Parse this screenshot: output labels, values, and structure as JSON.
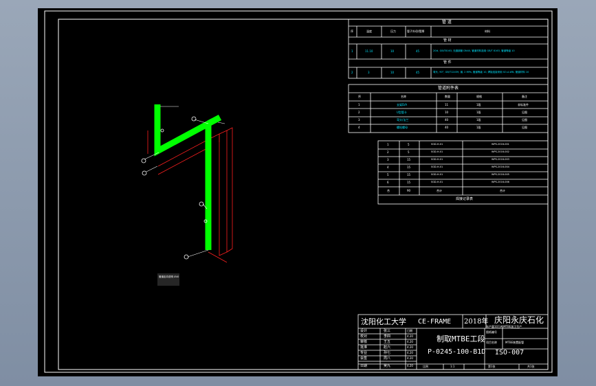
{
  "colors": {
    "background": "#000000",
    "frame": "#ffffff",
    "pipe": "#00ff00",
    "dimension": "#ff2020",
    "cyan_text": "#00e5ff"
  },
  "top_table": {
    "title": "管 道",
    "headers": [
      "序",
      "温度",
      "压力",
      "管子外径/壁厚",
      "材料"
    ],
    "section1": "管 材",
    "row1": [
      "1",
      "11.10",
      "10",
      "45",
      "20#, GB/T8163, 无缝钢管 DN40, 管道材料选用 GB/T 8163, 管道等级 10"
    ],
    "section2": "管 件",
    "row2": [
      "2",
      "3",
      "10",
      "45",
      "弯头, 90°, GB/T12459, 钢, 2 MPa, 管道等级 10, 焊接连接采用 SO-A-WN, 管道材料 10"
    ]
  },
  "mid_table": {
    "title": "管道附件表",
    "headers": [
      "序",
      "名称",
      "数量",
      "规格",
      "备注"
    ],
    "rows": [
      [
        "1",
        "支架D/A",
        "11",
        "1段",
        "非标准件"
      ],
      [
        "2",
        "U型管卡",
        "10",
        "1段",
        "见图"
      ],
      [
        "3",
        "弯头/法兰",
        "40",
        "1段",
        "见图"
      ],
      [
        "4",
        "螺栓螺母",
        "40",
        "1段",
        "见图"
      ]
    ]
  },
  "weld_table": {
    "rows": [
      [
        "1",
        "5",
        "SGD-H-01",
        "WPS-2016-001"
      ],
      [
        "2",
        "5",
        "SGD-H-01",
        "WPS-2016-002"
      ],
      [
        "3",
        "15",
        "SGD-H-01",
        "WPS-2016-003"
      ],
      [
        "4",
        "15",
        "SGD-H-01",
        "WPS-2016-004"
      ],
      [
        "5",
        "15",
        "SGD-H-01",
        "WPS-2016-005"
      ],
      [
        "6",
        "15",
        "SGD-H-01",
        "WPS-2016-006"
      ],
      [
        "合",
        "90",
        "合计",
        "合计"
      ]
    ],
    "footer": "焊接记录表"
  },
  "title_block": {
    "school": "沈阳化工大学",
    "frame": "CE-FRAME",
    "year": "2018年",
    "company": "庆阳永庆石化",
    "note": "年产量10万吨MTBE加工生产",
    "roles": [
      "设计",
      "校对",
      "审核",
      "批准",
      "专业",
      "会签",
      "日期"
    ],
    "names": [
      "张三",
      "李四",
      "王五",
      "赵六",
      "孙七",
      "周八",
      "吴九"
    ],
    "stamps": [
      "日期",
      "4.20",
      "4.20",
      "4.20",
      "4.20",
      "4.20",
      "4.20"
    ],
    "drawing_title": "制取MTBE工段",
    "line_number": "P-0245-100-B1D",
    "drawing_no": "ISO-007",
    "meta_labels": [
      "图纸编号",
      "项目名称"
    ],
    "meta_values": [
      "",
      "MTBE装置配管"
    ],
    "footer": [
      "比例",
      "1:1",
      "第1张",
      "共1张"
    ]
  },
  "annotations": {
    "legend_text": "管道走向说明 Ø40"
  }
}
